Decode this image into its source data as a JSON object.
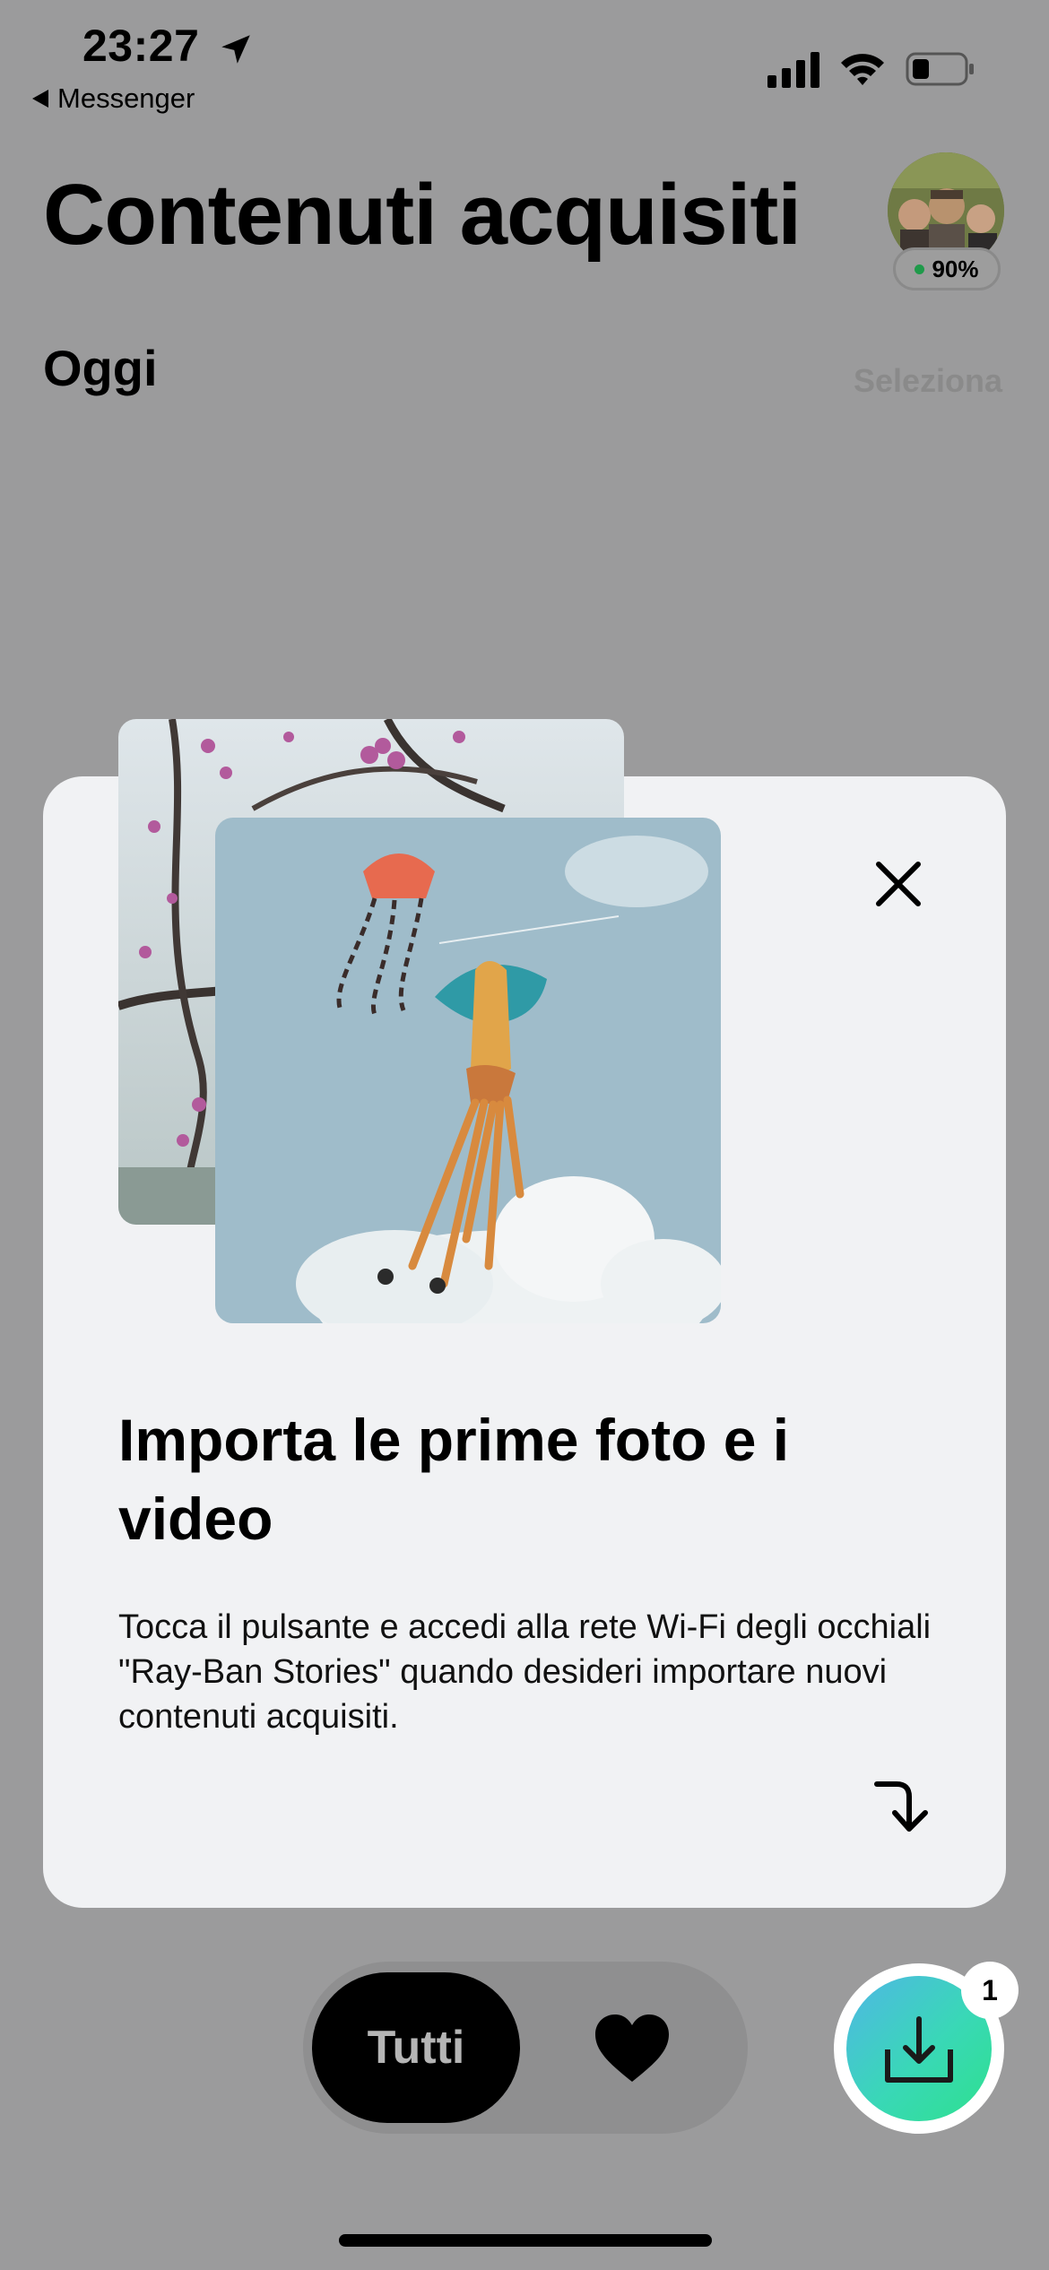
{
  "status_bar": {
    "time": "23:27",
    "back_label": "Messenger",
    "icons": [
      "location-arrow-icon",
      "cellular-signal-icon",
      "wifi-icon",
      "battery-icon"
    ]
  },
  "header": {
    "title": "Contenuti acquisiti",
    "device_battery": "90%",
    "section_label": "Oggi",
    "select_label": "Seleziona"
  },
  "onboarding_card": {
    "title": "Importa le prime foto e i video",
    "body": "Tocca il pulsante e accedi alla rete Wi-Fi degli occhiali \"Ray-Ban Stories\" quando desideri importare nuovi contenuti acquisiti.",
    "close_icon": "close-icon",
    "arrow_icon": "curved-arrow-down-right-icon"
  },
  "filter_bar": {
    "tabs": [
      {
        "label": "Tutti",
        "selected": true
      },
      {
        "icon": "heart-icon",
        "selected": false
      }
    ]
  },
  "import_button": {
    "icon": "download-tray-icon",
    "badge": "1",
    "gradient": [
      "#4fb7e5",
      "#2ee08e"
    ]
  },
  "colors": {
    "overlay_background": "#9b9b9c",
    "card_background": "#f1f2f4",
    "status_dot": "#1f9a4a"
  }
}
